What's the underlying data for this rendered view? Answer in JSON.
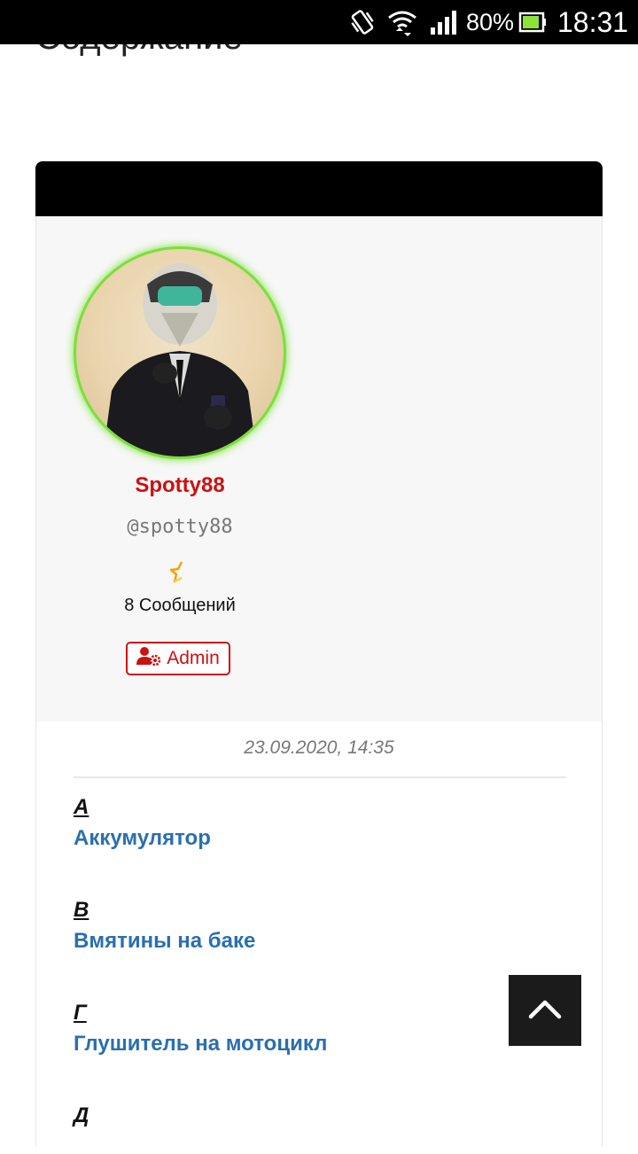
{
  "status_bar": {
    "battery_percent": "80%",
    "time": "18:31",
    "icons": [
      "vibrate-icon",
      "wifi-icon",
      "signal-icon",
      "battery-icon"
    ]
  },
  "page": {
    "heading": "Содержание"
  },
  "author": {
    "name": "Spotty88",
    "handle": "@spotty88",
    "posts_count": "8 Сообщений",
    "role": "Admin",
    "rank_icon": "rank-star-icon",
    "role_icon": "user-cog-icon",
    "colors": {
      "name": "#cc1111",
      "avatar_ring": "#7be03a"
    }
  },
  "post": {
    "date": "23.09.2020, 14:35",
    "sections": [
      {
        "letter": "А",
        "link": "Аккумулятор"
      },
      {
        "letter": "В",
        "link": "Вмятины на баке"
      },
      {
        "letter": "Г",
        "link": "Глушитель на мотоцикл"
      },
      {
        "letter": "Д",
        "link": ""
      }
    ],
    "link_color": "#2a6fb0"
  },
  "back_to_top": {
    "icon": "chevron-up-icon"
  }
}
